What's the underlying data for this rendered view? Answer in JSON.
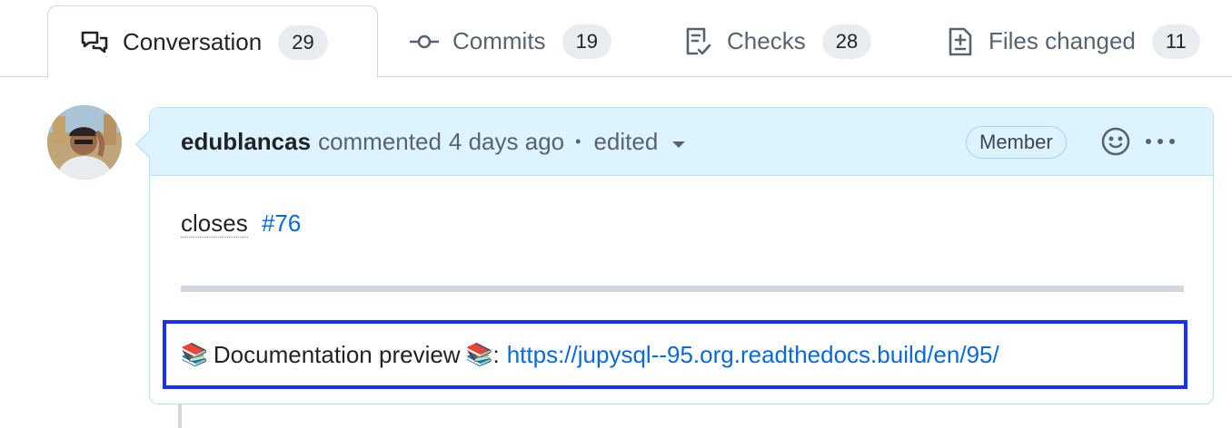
{
  "tabs": [
    {
      "label": "Conversation",
      "count": "29",
      "icon": "comment-discussion-icon",
      "active": true
    },
    {
      "label": "Commits",
      "count": "19",
      "icon": "git-commit-icon"
    },
    {
      "label": "Checks",
      "count": "28",
      "icon": "checklist-icon"
    },
    {
      "label": "Files changed",
      "count": "11",
      "icon": "file-diff-icon"
    }
  ],
  "comment": {
    "author": "edublancas",
    "action": "commented",
    "time": "4 days ago",
    "separator": "•",
    "edited": "edited",
    "role_badge": "Member",
    "body": {
      "closes_text": "closes",
      "issue_ref": "#76"
    },
    "preview": {
      "emoji": "📚",
      "label": "Documentation preview",
      "colon": ":",
      "url": "https://jupysql--95.org.readthedocs.build/en/95/"
    }
  },
  "colors": {
    "header_bg": "#ddf4ff",
    "header_border": "#b6e3ff",
    "link": "#0969da",
    "highlight_box": "#1530ff"
  }
}
